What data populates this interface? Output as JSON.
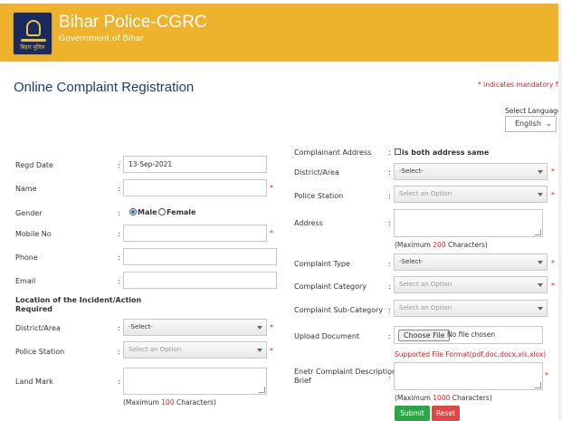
{
  "header": {
    "title": "Bihar Police-CGRC",
    "subtitle": "Government of Bihar",
    "logo_text": "बिहार पुलिस"
  },
  "page": {
    "title": "Online Complaint Registration",
    "mandatory_note": "* indicates mandatory field",
    "language_label": "Select Language :",
    "language_value": "English"
  },
  "left": {
    "regd_date": {
      "label": "Regd Date",
      "value": "13-Sep-2021"
    },
    "name": {
      "label": "Name",
      "value": ""
    },
    "gender": {
      "label": "Gender",
      "male": "Male",
      "female": "Female"
    },
    "mobile": {
      "label": "Mobile No",
      "value": ""
    },
    "phone": {
      "label": "Phone",
      "value": ""
    },
    "email": {
      "label": "Email",
      "value": ""
    },
    "location_heading_1": "Location of the Incident/Action",
    "location_heading_2": "Required",
    "district": {
      "label": "District/Area",
      "value": "-Select-"
    },
    "police_station": {
      "label": "Police Station",
      "placeholder": "Select an Option"
    },
    "landmark": {
      "label": "Land Mark",
      "hint_prefix": "(Maximum",
      "hint_count": "100",
      "hint_suffix": "Characters)"
    }
  },
  "right": {
    "complainant_address": {
      "label": "Complainant Address",
      "checkbox_label": "is both address same"
    },
    "district": {
      "label": "District/Area",
      "value": "-Select-"
    },
    "police_station": {
      "label": "Police Station",
      "placeholder": "Select an Option"
    },
    "address": {
      "label": "Address",
      "hint_prefix": "(Maximum",
      "hint_count": "200",
      "hint_suffix": "Characters)"
    },
    "complaint_type": {
      "label": "Complaint Type",
      "value": "-Select-"
    },
    "complaint_category": {
      "label": "Complaint Category",
      "placeholder": "Select an Option"
    },
    "complaint_subcategory": {
      "label": "Complaint Sub-Category",
      "placeholder": "Select an Option"
    },
    "upload": {
      "label": "Upload Document",
      "button": "Choose File",
      "status": "No file chosen",
      "supported": "Supported File Format(pdf,doc,docx,xls,xlsx)"
    },
    "description": {
      "label_1": "Enetr Complaint Description in",
      "label_2": "Brief",
      "hint_prefix": "(Maximum",
      "hint_count": "1000",
      "hint_suffix": "Characters)"
    }
  },
  "buttons": {
    "submit": "Submit",
    "reset": "Reset"
  },
  "symbols": {
    "colon": ":",
    "required": "*"
  },
  "colors": {
    "header": "#eeb22d",
    "title": "#1f3b7a",
    "required": "#e02020",
    "submit": "#27a844",
    "reset": "#e04646"
  }
}
